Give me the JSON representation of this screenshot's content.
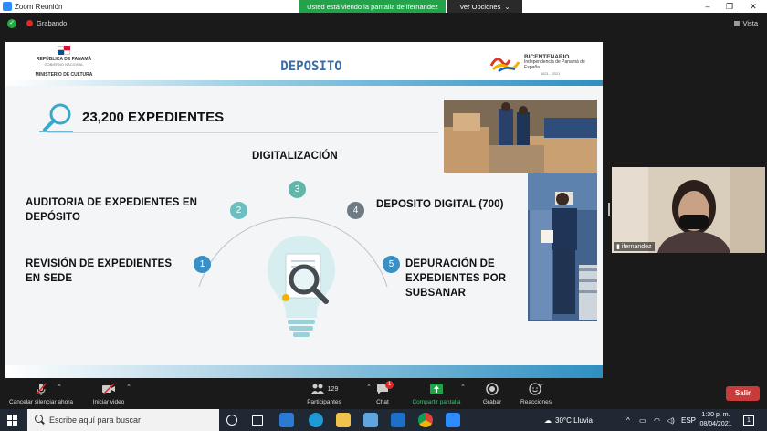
{
  "window": {
    "title": "Zoom Reunión",
    "share_banner": "Usted está viendo la pantalla de ifernandez",
    "options_label": "Ver Opciones"
  },
  "meeting": {
    "recording_label": "Grabando",
    "view_label": "Vista"
  },
  "slide": {
    "org_line1": "REPÚBLICA DE PANAMÁ",
    "org_line2": "GOBIERNO NACIONAL",
    "org_line3": "MINISTERIO DE CULTURA",
    "title": "DEPOSITO",
    "bicentenario_title": "BICENTENARIO",
    "bicentenario_sub": "Independencia de Panamá de España",
    "bicentenario_years": "1821 - 2021",
    "count_text": "23,200 EXPEDIENTES",
    "steps": [
      {
        "num": "1",
        "label": "REVISIÓN DE EXPEDIENTES EN SEDE",
        "color": "#3a8fc4"
      },
      {
        "num": "2",
        "label": "AUDITORIA DE EXPEDIENTES EN DEPÓSITO",
        "color": "#6bbfc0"
      },
      {
        "num": "3",
        "label": "DIGITALIZACIÓN",
        "color": "#62b5a9"
      },
      {
        "num": "4",
        "label": "DEPOSITO DIGITAL (700)",
        "color": "#6f7b85"
      },
      {
        "num": "5",
        "label": "DEPURACIÓN DE EXPEDIENTES POR SUBSANAR",
        "color": "#3a8fc4"
      }
    ],
    "step1_line1": "REVISIÓN DE EXPEDIENTES",
    "step1_line2": "EN SEDE",
    "step2_line1": "AUDITORIA DE EXPEDIENTES EN",
    "step2_line2": "DEPÓSITO",
    "step5_line1": "DEPURACIÓN DE",
    "step5_line2": "EXPEDIENTES POR",
    "step5_line3": "SUBSANAR"
  },
  "participant": {
    "name": "ifernandez"
  },
  "toolbar": {
    "mute_label": "Cancelar silenciar ahora",
    "video_label": "Iniciar video",
    "participants_label": "Participantes",
    "participants_count": "129",
    "chat_label": "Chat",
    "chat_badge": "1",
    "share_label": "Compartir pantalla",
    "record_label": "Grabar",
    "reactions_label": "Reacciones",
    "leave_label": "Salir"
  },
  "taskbar": {
    "search_placeholder": "Escribe aquí para buscar",
    "weather": "30°C  Lluvia",
    "language": "ESP",
    "time": "1:30 p. m.",
    "date": "08/04/2021",
    "notification_count": "1"
  },
  "colors": {
    "accent": "#2d8fc0",
    "share_green": "#22a34a",
    "leave_red": "#c93a3a"
  }
}
